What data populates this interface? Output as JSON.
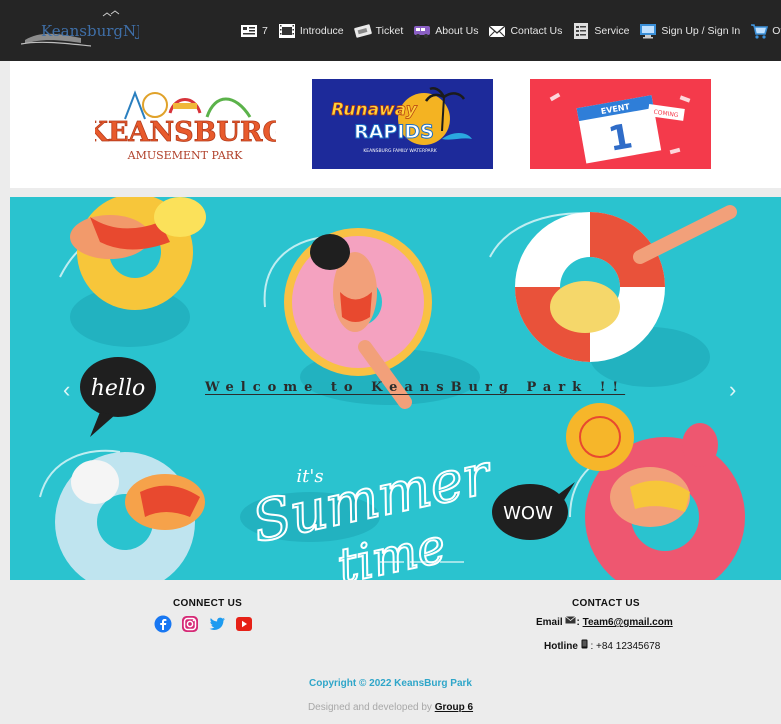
{
  "nav": {
    "logo_text": "KeansburgNJ",
    "items": [
      {
        "label": "7",
        "icon": "notice-board-icon"
      },
      {
        "label": "Introduce",
        "icon": "film-strip-icon"
      },
      {
        "label": "Ticket",
        "icon": "ticket-icon"
      },
      {
        "label": "About Us",
        "icon": "bus-icon"
      },
      {
        "label": "Contact Us",
        "icon": "mail-icon"
      },
      {
        "label": "Service",
        "icon": "checklist-icon"
      },
      {
        "label": "Sign Up / Sign In",
        "icon": "monitor-icon"
      },
      {
        "label": "Other",
        "icon": "cart-icon"
      }
    ]
  },
  "banners": [
    {
      "title": "KEANSBURG",
      "subtitle": "AMUSEMENT PARK"
    },
    {
      "title": "Runaway",
      "title2": "RAPIDS",
      "subtitle": "KEANSBURG FAMILY WATERPARK"
    },
    {
      "label": "EVENT",
      "number": "1",
      "extra": "COMING"
    }
  ],
  "hero": {
    "title": "Welcome to KeansBurg Park !!",
    "bubble_hello": "hello",
    "bubble_wow": "WOW",
    "summer_line1": "it's",
    "summer_line2": "Summer",
    "summer_line3": "time"
  },
  "footer": {
    "connect_title": "CONNECT US",
    "contact_title": "CONTACT US",
    "email_label": "Email",
    "email_value": "Team6@gmail.com",
    "hotline_label": "Hotline",
    "hotline_value": "+84 12345678",
    "copyright": "Copyright © 2022 KeansBurg Park",
    "designed_prefix": "Designed and developed by",
    "designed_by": "Group 6"
  },
  "colors": {
    "nav_bg": "#252525",
    "hero_bg": "#2ac3cf",
    "copyright": "#2fa6c9",
    "facebook": "#1877f2",
    "instagram": "#d62976",
    "twitter": "#1d9bf0",
    "youtube": "#e62117"
  }
}
